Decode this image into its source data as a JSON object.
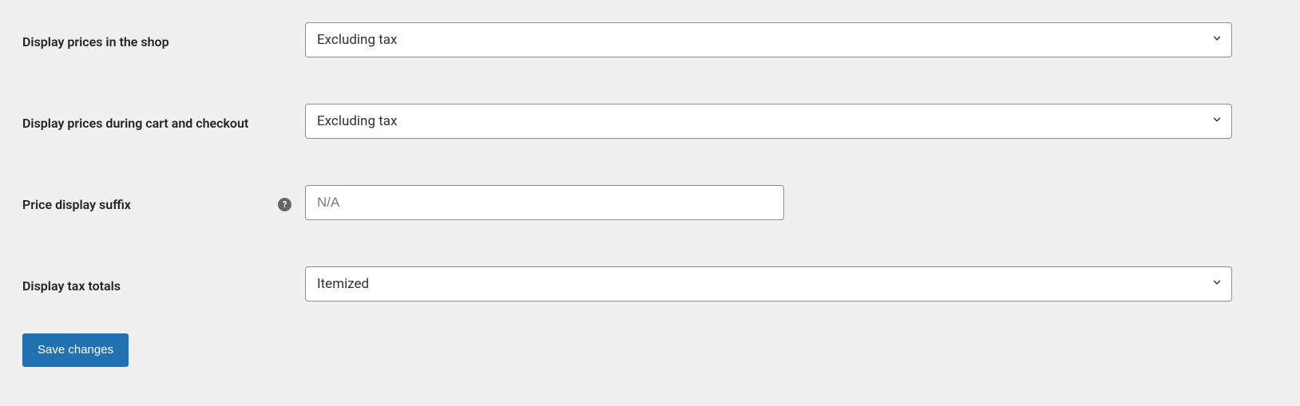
{
  "fields": {
    "display_prices_shop": {
      "label": "Display prices in the shop",
      "value": "Excluding tax"
    },
    "display_prices_cart": {
      "label": "Display prices during cart and checkout",
      "value": "Excluding tax"
    },
    "price_display_suffix": {
      "label": "Price display suffix",
      "placeholder": "N/A",
      "value": ""
    },
    "display_tax_totals": {
      "label": "Display tax totals",
      "value": "Itemized"
    }
  },
  "buttons": {
    "save": "Save changes"
  },
  "help_tooltip": "?"
}
